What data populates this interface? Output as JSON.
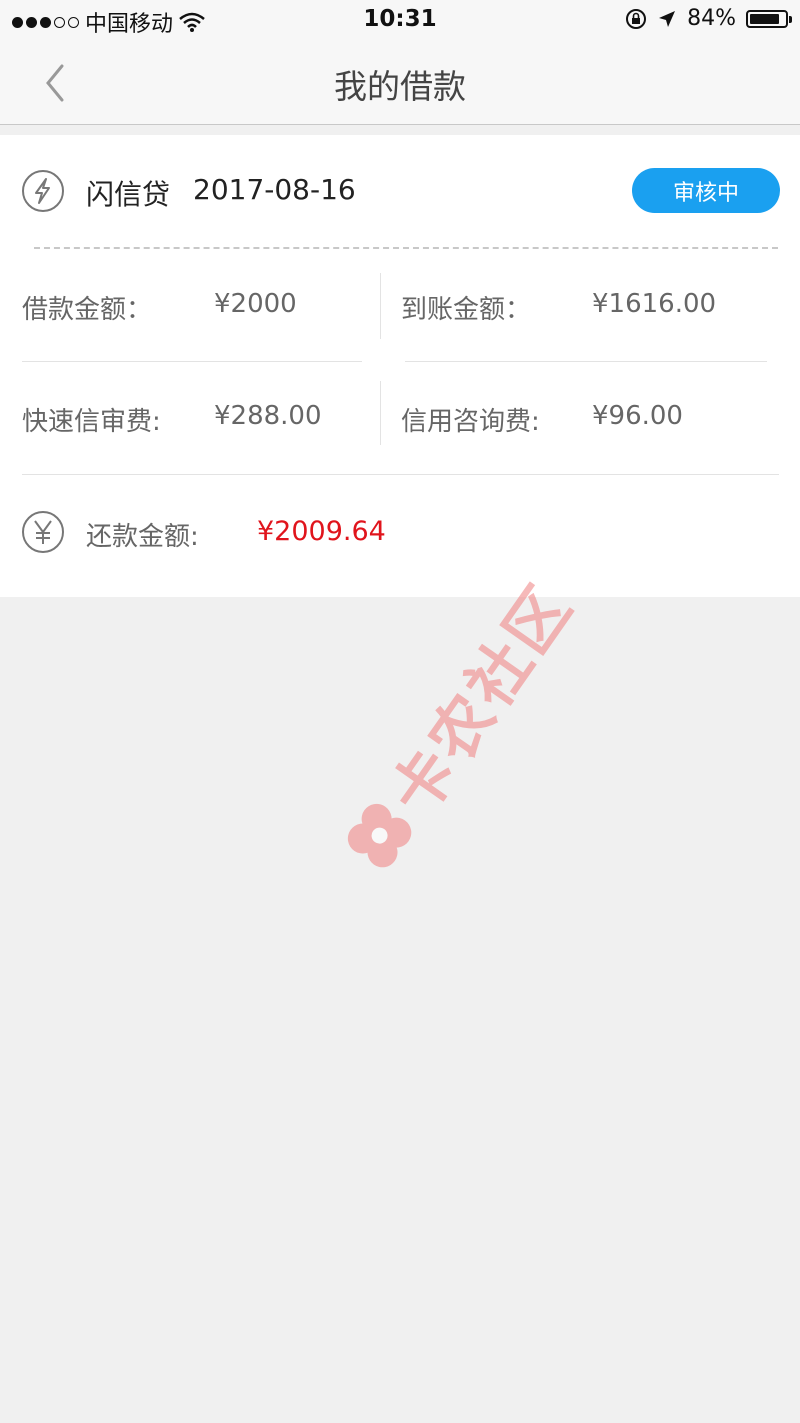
{
  "status_bar": {
    "carrier": "中国移动",
    "time": "10:31",
    "battery_percent": "84%",
    "battery_level": 0.84,
    "icons": [
      "signal-dots-icon",
      "wifi-icon",
      "orientation-lock-icon",
      "location-arrow-icon",
      "battery-icon"
    ]
  },
  "nav": {
    "title": "我的借款",
    "back_icon": "chevron-left-icon"
  },
  "loan": {
    "product": "闪信贷",
    "date": "2017-08-16",
    "status": "审核中",
    "header_icon": "lightning-icon",
    "fields": [
      {
        "label": "借款金额：",
        "value": "¥2000"
      },
      {
        "label": "到账金额：",
        "value": "¥1616.00"
      },
      {
        "label": "快速信审费:",
        "value": "¥288.00"
      },
      {
        "label": "信用咨询费:",
        "value": "¥96.00"
      }
    ],
    "repayment": {
      "icon": "yen-icon",
      "label": "还款金额:",
      "value": "¥2009.64"
    }
  },
  "watermark": {
    "text": "卡农社区",
    "icon": "logo-icon"
  },
  "colors": {
    "accent": "#1aa0f0",
    "amount_red": "#e0141c",
    "background": "#f0f0f0",
    "watermark": "#f08080"
  }
}
